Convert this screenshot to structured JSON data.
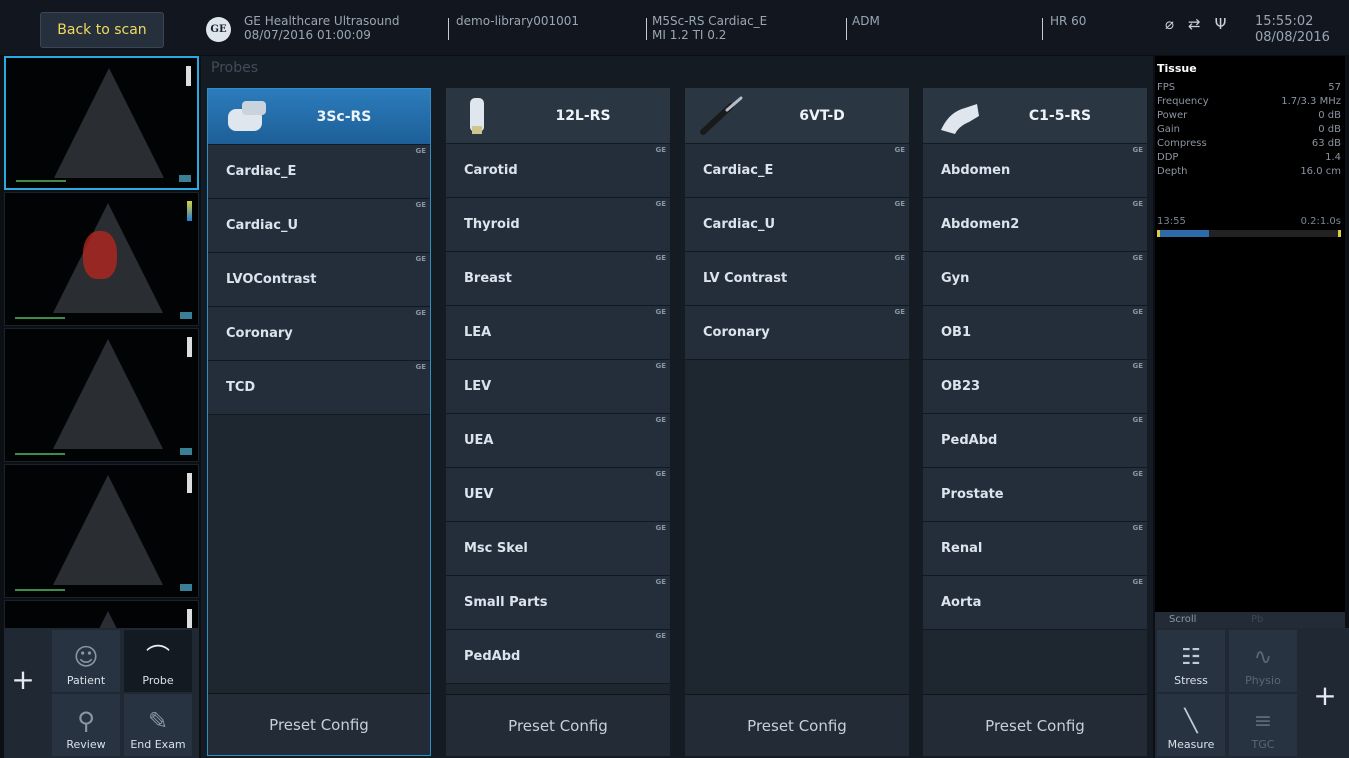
{
  "header": {
    "back_label": "Back to scan",
    "ge_logo_text": "GE",
    "system_name": "GE Healthcare Ultrasound",
    "system_date": "08/07/2016 01:00:09",
    "library": "demo-library001001",
    "probe_info": "M5Sc-RS  Cardiac_E",
    "mi_ti": "MI 1.2  TI 0.2",
    "user": "ADM",
    "heart_rate": "HR 60",
    "time": "15:55:02",
    "date": "08/08/2016",
    "icons": [
      "no-signal-icon",
      "network-icon",
      "usb-icon"
    ]
  },
  "left_nav": {
    "add_label": "+",
    "patient_label": "Patient",
    "probe_label": "Probe",
    "review_label": "Review",
    "end_exam_label": "End Exam"
  },
  "center": {
    "section_title": "Probes",
    "preset_config_label": "Preset Config",
    "probes": [
      {
        "name": "3Sc-RS",
        "presets": [
          "Cardiac_E",
          "Cardiac_U",
          "LVOContrast",
          "Coronary",
          "TCD"
        ]
      },
      {
        "name": "12L-RS",
        "presets": [
          "Carotid",
          "Thyroid",
          "Breast",
          "LEA",
          "LEV",
          "UEA",
          "UEV",
          "Msc Skel",
          "Small Parts",
          "PedAbd"
        ]
      },
      {
        "name": "6VT-D",
        "presets": [
          "Cardiac_E",
          "Cardiac_U",
          "LV Contrast",
          "Coronary"
        ]
      },
      {
        "name": "C1-5-RS",
        "presets": [
          "Abdomen",
          "Abdomen2",
          "Gyn",
          "OB1",
          "OB23",
          "PedAbd",
          "Prostate",
          "Renal",
          "Aorta"
        ]
      }
    ]
  },
  "right_panel": {
    "title": "Tissue",
    "params": [
      {
        "label": "FPS",
        "value": "57"
      },
      {
        "label": "Frequency",
        "value": "1.7/3.3 MHz"
      },
      {
        "label": "Power",
        "value": "0 dB"
      },
      {
        "label": "Gain",
        "value": "0 dB"
      },
      {
        "label": "Compress",
        "value": "63 dB"
      },
      {
        "label": "DDP",
        "value": "1.4"
      },
      {
        "label": "Depth",
        "value": "16.0 cm"
      }
    ],
    "cine_time": "13:55",
    "cine_range": "0.2:1.0s",
    "scroll_label": "Scroll",
    "pb_label": "Pb"
  },
  "right_nav": {
    "stress_label": "Stress",
    "physio_label": "Physio",
    "measure_label": "Measure",
    "tgc_label": "TGC",
    "add_label": "+"
  }
}
